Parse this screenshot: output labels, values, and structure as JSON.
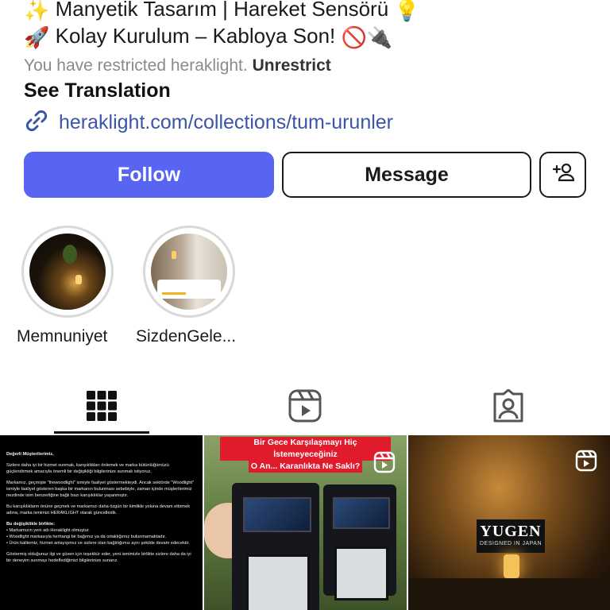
{
  "bio": {
    "line1_prefix": "✨",
    "line1": "Manyetik Tasarım | Hareket Sensörü",
    "line1_suffix": "💡",
    "line2_prefix": "🚀",
    "line2": "Kolay Kurulum – Kabloya Son!",
    "line2_suffix": "🚫🔌"
  },
  "restricted": {
    "text": "You have restricted heraklight.",
    "action": "Unrestrict"
  },
  "see_translation": "See Translation",
  "link": {
    "icon": "link-icon",
    "text": "heraklight.com/collections/tum-urunler"
  },
  "actions": {
    "follow": "Follow",
    "message": "Message",
    "add_user_icon": "add-user-icon"
  },
  "colors": {
    "follow_bg": "#5865f2",
    "link": "#3b55a8"
  },
  "highlights": [
    {
      "label": "Memnuniyet"
    },
    {
      "label": "SizdenGele..."
    }
  ],
  "tabs": [
    {
      "icon": "grid-icon",
      "active": true
    },
    {
      "icon": "reels-icon",
      "active": false
    },
    {
      "icon": "tagged-icon",
      "active": false
    }
  ],
  "posts": {
    "post1": {
      "greeting": "Değerli Müşterilerimiz,",
      "p1": "Sizlere daha iyi bir hizmet sunmak, karışıklıkları önlemek ve marka bütünlüğümüzü güçlendirmek amacıyla önemli bir değişikliği bilgilerinize sunmak istiyoruz.",
      "p2": "Markamız, geçmişte \"thewoodlight\" ismiyle faaliyet göstermekteydi. Ancak sektörde \"Woodlight\" ismiyle faaliyet gösteren başka bir markanın bulunması sebebiyle, zaman içinde müşterilerimiz nezdinde isim benzerliğine bağlı bazı karışıklıklar yaşanmıştır.",
      "p3": "Bu karışıklıkların önüne geçmek ve markamızı daha özgün bir kimlikle yoluna devam ettirmek adına, marka ismimizi HERAKLIGHT olarak güncelledik.",
      "p4_title": "Bu değişiklikle birlikte:",
      "b1": "• Markamızın yeni adı Heraklight olmuştur.",
      "b2": "• Woodlight markasıyla herhangi bir bağımız ya da ortaklığımız bulunmamaktadır.",
      "b3": "• Ürün kalitemiz, hizmet anlayışımız ve sizlere olan bağlılığımız aynı şekilde devam edecektir.",
      "p5": "Göstermiş olduğunuz ilgi ve güven için teşekkür eder, yeni ismimizle birlikte sizlere daha da iyi bir deneyim sunmayı hedeflediğimizi bilgilerinize sunarız."
    },
    "post2": {
      "caption1": "Bir Gece Karşılaşmayı Hiç İstemeyeceğiniz",
      "caption2": "O An... Karanlıkta Ne Saklı?",
      "icon": "reel-icon"
    },
    "post3": {
      "brand": "YUGEN",
      "sub": "DESIGNED IN JAPAN",
      "icon": "reel-icon"
    }
  }
}
